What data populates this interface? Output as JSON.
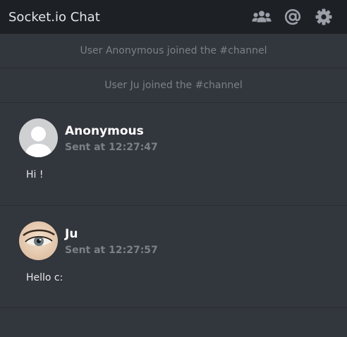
{
  "header": {
    "title": "Socket.io Chat",
    "icons": [
      "users-icon",
      "at-mention-icon",
      "gear-icon"
    ]
  },
  "notices": [
    "User Anonymous joined the #channel",
    "User Ju joined the #channel"
  ],
  "messages": [
    {
      "author": "Anonymous",
      "sent": "Sent at 12:27:47",
      "text": "Hi !",
      "avatar": "default-avatar"
    },
    {
      "author": "Ju",
      "sent": "Sent at 12:27:57",
      "text": "Hello c:",
      "avatar": "eye-photo-avatar"
    }
  ],
  "colors": {
    "header_bg": "#1d2024",
    "body_bg": "#32363d",
    "muted_text": "#7b8089"
  }
}
